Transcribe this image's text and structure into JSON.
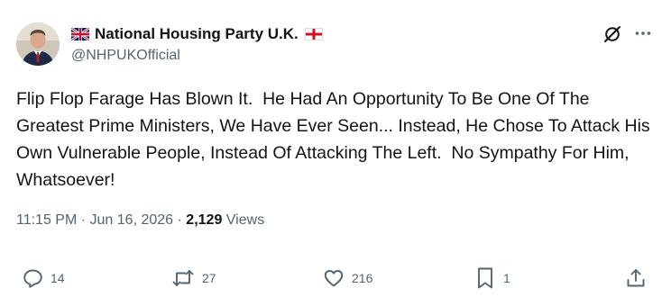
{
  "author": {
    "display_name": "National Housing Party U.K.",
    "handle": "@NHPUKOfficial"
  },
  "post": {
    "text": "Flip Flop Farage Has Blown It.  He Had An Opportunity To Be One Of The Greatest Prime Ministers, We Have Ever Seen... Instead, He Chose To Attack His Own Vulnerable People, Instead Of Attacking The Left.  No Sympathy For Him, Whatsoever!",
    "time": "11:15 PM",
    "date": "Jun 16, 2026",
    "views_count": "2,129",
    "views_label": "Views"
  },
  "actions": {
    "replies": "14",
    "reposts": "27",
    "likes": "216",
    "bookmarks": "1"
  },
  "icons": {
    "header": [
      "grok-icon",
      "more-icon"
    ],
    "actions": [
      "reply-icon",
      "repost-icon",
      "like-icon",
      "bookmark-icon",
      "share-icon"
    ]
  },
  "colors": {
    "text": "#0f1419",
    "secondary": "#536471",
    "background": "#ffffff"
  }
}
